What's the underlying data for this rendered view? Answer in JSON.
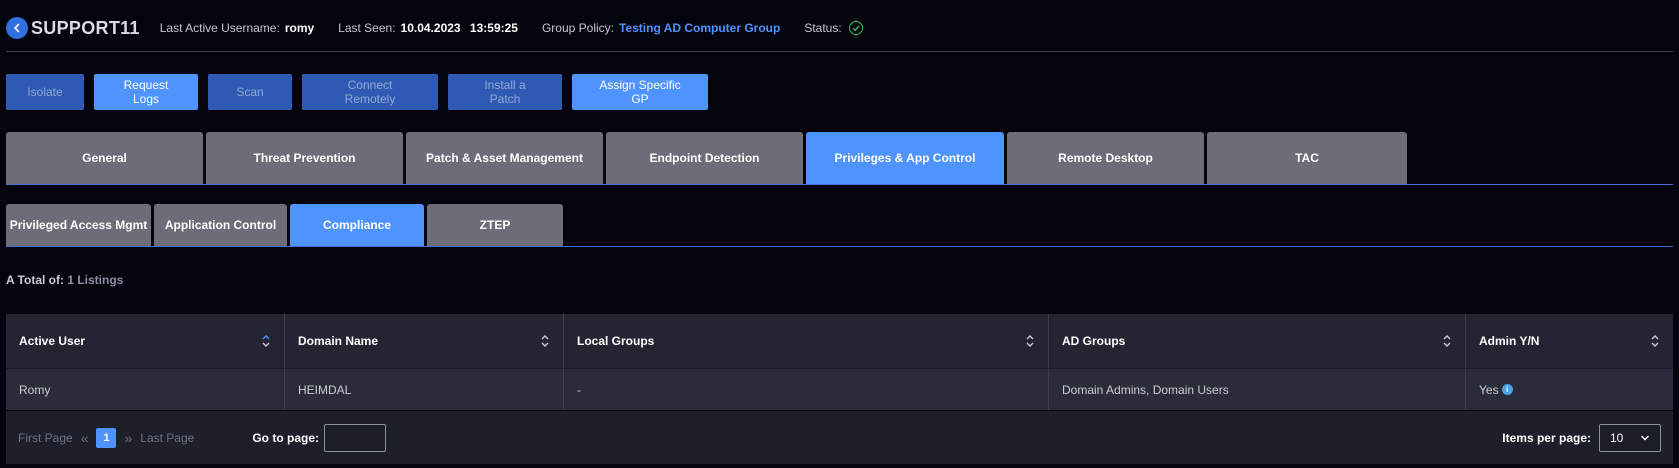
{
  "header": {
    "device_name": "SUPPORT11",
    "last_active_label": "Last Active Username:",
    "last_active_value": "romy",
    "last_seen_label": "Last Seen:",
    "last_seen_value": "10.04.2023  13:59:25",
    "group_policy_label": "Group Policy:",
    "group_policy_value": "Testing AD Computer Group",
    "status_label": "Status:",
    "status_icon": "check-circle-icon",
    "status_color": "#37c257"
  },
  "actions": [
    {
      "label": "Isolate",
      "enabled": false
    },
    {
      "label": "Request Logs",
      "enabled": true
    },
    {
      "label": "Scan",
      "enabled": false
    },
    {
      "label": "Connect Remotely",
      "enabled": false
    },
    {
      "label": "Install a Patch",
      "enabled": false
    },
    {
      "label": "Assign Specific GP",
      "enabled": true
    }
  ],
  "tabs": [
    {
      "label": "General",
      "active": false
    },
    {
      "label": "Threat Prevention",
      "active": false
    },
    {
      "label": "Patch & Asset Management",
      "active": false
    },
    {
      "label": "Endpoint Detection",
      "active": false
    },
    {
      "label": "Privileges & App Control",
      "active": true
    },
    {
      "label": "Remote Desktop",
      "active": false
    },
    {
      "label": "TAC",
      "active": false
    }
  ],
  "subtabs": [
    {
      "label": "Privileged Access Mgmt",
      "active": false
    },
    {
      "label": "Application Control",
      "active": false
    },
    {
      "label": "Compliance",
      "active": true
    },
    {
      "label": "ZTEP",
      "active": false
    }
  ],
  "total": {
    "label": "A Total of:",
    "value": "1 Listings"
  },
  "table": {
    "columns": [
      {
        "label": "Active User",
        "sorted": "asc"
      },
      {
        "label": "Domain Name",
        "sorted": "none"
      },
      {
        "label": "Local Groups",
        "sorted": "none"
      },
      {
        "label": "AD Groups",
        "sorted": "none"
      },
      {
        "label": "Admin Y/N",
        "sorted": "none"
      }
    ],
    "rows": [
      [
        "Romy",
        "HEIMDAL",
        "-",
        "Domain Admins, Domain Users",
        "Yes"
      ]
    ]
  },
  "pagination": {
    "first_label": "First Page",
    "last_label": "Last Page",
    "current_page": "1",
    "goto_label": "Go to page:",
    "goto_value": "",
    "items_per_page_label": "Items per page:",
    "items_per_page_value": "10"
  },
  "colors": {
    "accent": "#4f93ff",
    "disabled_button": "#2f5ab3",
    "tab_inactive": "#6c6d78",
    "background": "#04040f"
  }
}
